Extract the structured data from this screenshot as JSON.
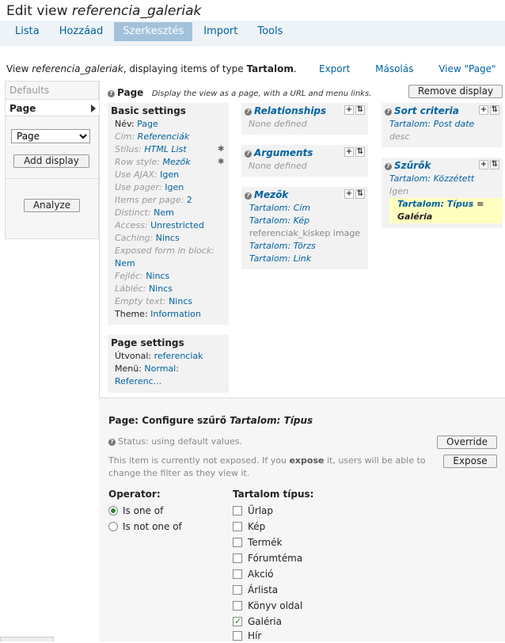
{
  "title": {
    "prefix": "Edit view ",
    "name": "referencia_galeriak"
  },
  "tabs": [
    {
      "label": "Lista",
      "active": false
    },
    {
      "label": "Hozzáad",
      "active": false
    },
    {
      "label": "Szerkesztés",
      "active": true
    },
    {
      "label": "Import",
      "active": false
    },
    {
      "label": "Tools",
      "active": false
    }
  ],
  "view_desc": {
    "prefix": "View ",
    "name": "referencia_galeriak",
    "middle": ", displaying items of type ",
    "type": "Tartalom",
    "suffix": "."
  },
  "view_links": {
    "export": "Export",
    "masolas": "Másolás",
    "view_page": "View \"Page\""
  },
  "sidebar": {
    "defaults": "Defaults",
    "page": "Page",
    "select_value": "Page",
    "add_display": "Add display",
    "analyze": "Analyze"
  },
  "display": {
    "name": "Page",
    "desc": "Display the view as a page, with a URL and menu links.",
    "remove": "Remove display"
  },
  "basic": {
    "title": "Basic settings",
    "rows": [
      {
        "k": "Név:",
        "v": "Page",
        "dim": false,
        "it": false
      },
      {
        "k": "Cím:",
        "v": "Referenciák",
        "dim": true,
        "it": true
      },
      {
        "k": "Stílus:",
        "v": "HTML List",
        "dim": true,
        "it": true
      },
      {
        "k": "Row style:",
        "v": "Mezők",
        "dim": true,
        "it": true
      },
      {
        "k": "Use AJAX:",
        "v": "Igen",
        "dim": true,
        "it": false
      },
      {
        "k": "Use pager:",
        "v": "Igen",
        "dim": true,
        "it": false
      },
      {
        "k": "Items per page:",
        "v": "2",
        "dim": true,
        "it": false
      },
      {
        "k": "Distinct:",
        "v": "Nem",
        "dim": true,
        "it": false
      },
      {
        "k": "Access:",
        "v": "Unrestricted",
        "dim": true,
        "it": false
      },
      {
        "k": "Caching:",
        "v": "Nincs",
        "dim": true,
        "it": false
      },
      {
        "k": "Exposed form in block:",
        "v": "",
        "dim": true,
        "it": false
      },
      {
        "k": "",
        "v": "Nem",
        "dim": true,
        "it": false
      },
      {
        "k": "Fejléc:",
        "v": "Nincs",
        "dim": true,
        "it": false
      },
      {
        "k": "Lábléc:",
        "v": "Nincs",
        "dim": true,
        "it": false
      },
      {
        "k": "Empty text:",
        "v": "Nincs",
        "dim": true,
        "it": false
      },
      {
        "k": "Theme:",
        "v": "Information",
        "dim": false,
        "it": false
      }
    ]
  },
  "page_settings": {
    "title": "Page settings",
    "utvonal_k": "Útvonal:",
    "utvonal_v": "referenciak",
    "menu_k": "Menü:",
    "menu_v": "Normal:",
    "menu_v2": "Referenc..."
  },
  "relationships": {
    "title": "Relationships",
    "none": "None defined"
  },
  "arguments": {
    "title": "Arguments",
    "none": "None defined"
  },
  "mezok": {
    "title": "Mezők",
    "items": [
      "Tartalom: Cím",
      "Tartalom: Kép",
      "referenciak_kiskep image",
      "Tartalom: Törzs",
      "Tartalom: Link"
    ]
  },
  "sort": {
    "title": "Sort criteria",
    "item": "Tartalom: Post date",
    "sub": "desc"
  },
  "szurok": {
    "title": "Szűrők",
    "item1": "Tartalom: Közzétett",
    "sub1": "Igen",
    "item2a": "Tartalom: Típus",
    "item2b": " = ",
    "item2c": "Galéria"
  },
  "configure": {
    "title_prefix": "Page: Configure szűrő ",
    "title_item": "Tartalom: Típus",
    "status": "Status: using default values.",
    "override": "Override",
    "expose_text1": "This item is currently not exposed. If you ",
    "expose_bold": "expose",
    "expose_text2": " it, users will be able to change the filter as they view it.",
    "expose": "Expose",
    "operator_label": "Operator:",
    "op1": "Is one of",
    "op2": "Is not one of",
    "tipus_label": "Tartalom típus:",
    "types": [
      {
        "label": "Űrlap",
        "checked": false
      },
      {
        "label": "Kép",
        "checked": false
      },
      {
        "label": "Termék",
        "checked": false
      },
      {
        "label": "Fórumtéma",
        "checked": false
      },
      {
        "label": "Akció",
        "checked": false
      },
      {
        "label": "Árlista",
        "checked": false
      },
      {
        "label": "Könyv oldal",
        "checked": false
      },
      {
        "label": "Galéria",
        "checked": true
      },
      {
        "label": "Hír",
        "checked": false
      }
    ]
  }
}
